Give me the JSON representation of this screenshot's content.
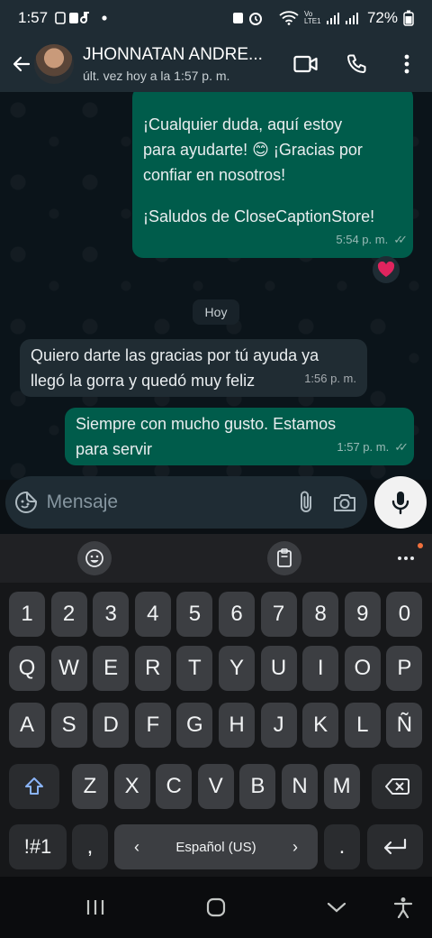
{
  "status_bar": {
    "time": "1:57",
    "battery": "72%",
    "network_label": "Vo LTE1"
  },
  "header": {
    "contact_name": "JHONNATAN ANDRE...",
    "last_seen": "últ. vez hoy a la 1:57 p. m."
  },
  "messages": [
    {
      "direction": "out",
      "lines": [
        "¡Cualquier duda, aquí estoy",
        "para ayudarte! 😊 ¡Gracias por",
        "confiar en nosotros!",
        "",
        "¡Saludos de CloseCaptionStore!"
      ],
      "time": "5:54 p. m.",
      "reaction": "heart"
    },
    {
      "direction": "in",
      "lines": [
        "Quiero darte las gracias por tú ayuda ya",
        "llegó la gorra y quedó muy feliz"
      ],
      "time": "1:56 p. m."
    },
    {
      "direction": "out",
      "lines": [
        "Siempre con mucho gusto. Estamos",
        "para servir"
      ],
      "time": "1:57 p. m."
    }
  ],
  "day_divider": "Hoy",
  "composer": {
    "placeholder": "Mensaje"
  },
  "keyboard": {
    "toolbar": [
      "emoji-icon",
      "clipboard-icon",
      "more-icon"
    ],
    "row_numbers": [
      "1",
      "2",
      "3",
      "4",
      "5",
      "6",
      "7",
      "8",
      "9",
      "0"
    ],
    "row_1": [
      "Q",
      "W",
      "E",
      "R",
      "T",
      "Y",
      "U",
      "I",
      "O",
      "P"
    ],
    "row_2": [
      "A",
      "S",
      "D",
      "F",
      "G",
      "H",
      "J",
      "K",
      "L",
      "Ñ"
    ],
    "row_3": [
      "Z",
      "X",
      "C",
      "V",
      "B",
      "N",
      "M"
    ],
    "symbols_key": "!#1",
    "comma_key": ",",
    "space_label": "Español (US)",
    "period_key": "."
  },
  "colors": {
    "outgoing_bubble": "#005c4b",
    "incoming_bubble": "#202c33",
    "header": "#1f2c34",
    "reaction_heart": "#e0245e"
  }
}
